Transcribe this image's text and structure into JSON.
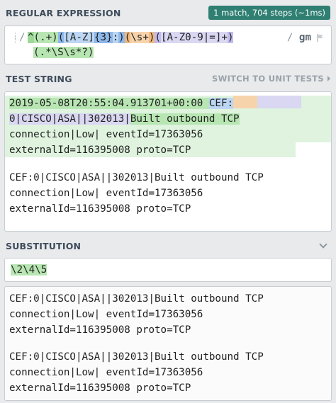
{
  "regex": {
    "header": "REGULAR EXPRESSION",
    "match_info": "1 match, 704 steps (~1ms)",
    "delimiter_open": "/",
    "flags_delim": "/",
    "flags": "gm",
    "tokens_line1": [
      "^",
      "(.+)",
      "(",
      "[A-Z]",
      "{3}",
      ":",
      ")",
      "(",
      "\\s+",
      ")",
      "(",
      "[A-Z0-9|=]",
      "+",
      ")"
    ],
    "tokens_line2": [
      "(.*\\S\\s*?)"
    ]
  },
  "test": {
    "header": "TEST STRING",
    "switch_label": "SWITCH TO UNIT TESTS",
    "lines": [
      "2019-05-08T20:55:04.913701+00:00 ",
      "CEF:",
      "0|CISCO|ASA||302013|",
      "Built outbound TCP",
      "connection|Low| eventId=17363056",
      "externalId=116395008 proto=TCP",
      "",
      "CEF:0|CISCO|ASA||302013|Built outbound TCP",
      "connection|Low| eventId=17363056",
      "externalId=116395008 proto=TCP"
    ]
  },
  "substitution": {
    "header": "SUBSTITUTION",
    "value": "\\2\\4\\5"
  },
  "result": {
    "lines": [
      "CEF:0|CISCO|ASA||302013|Built outbound TCP",
      "connection|Low| eventId=17363056",
      "externalId=116395008 proto=TCP",
      "",
      "CEF:0|CISCO|ASA||302013|Built outbound TCP",
      "connection|Low| eventId=17363056",
      "externalId=116395008 proto=TCP"
    ]
  },
  "colors": {
    "badge": "#2f7f72",
    "group1": "#b8e6b3",
    "group2": "#bcd6f3",
    "group3": "#f7d3ab",
    "group4": "#d9d7f1"
  }
}
